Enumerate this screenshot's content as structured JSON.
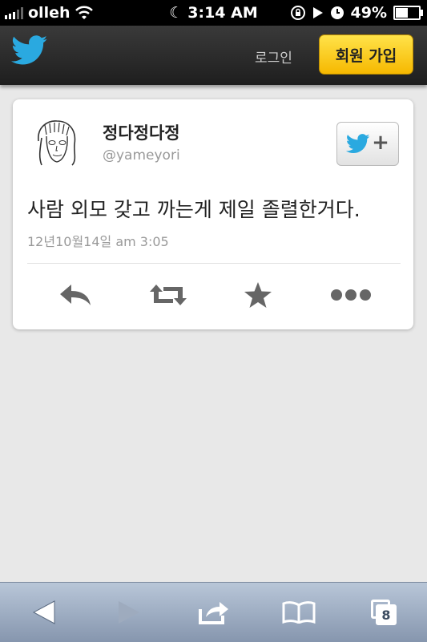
{
  "status_bar": {
    "carrier": "olleh",
    "time": "3:14 AM",
    "battery": "49%",
    "battery_level": 0.49
  },
  "header": {
    "logo": "twitter-bird-icon",
    "login_label": "로그인",
    "signup_label": "회원 가입",
    "accent_color": "#f6c000"
  },
  "tweet": {
    "name": "정다정다정",
    "handle": "@yameyori",
    "text": "사람 외모 갖고 까는게 제일 졸렬한거다.",
    "timestamp": "12년10월14일 am 3:05",
    "actions": [
      "reply-icon",
      "retweet-icon",
      "favorite-icon",
      "more-icon"
    ]
  },
  "toolbar": {
    "tab_count": "8"
  },
  "colors": {
    "twitter_blue": "#1da1f2",
    "bar_dark": "#2a2a2a"
  }
}
